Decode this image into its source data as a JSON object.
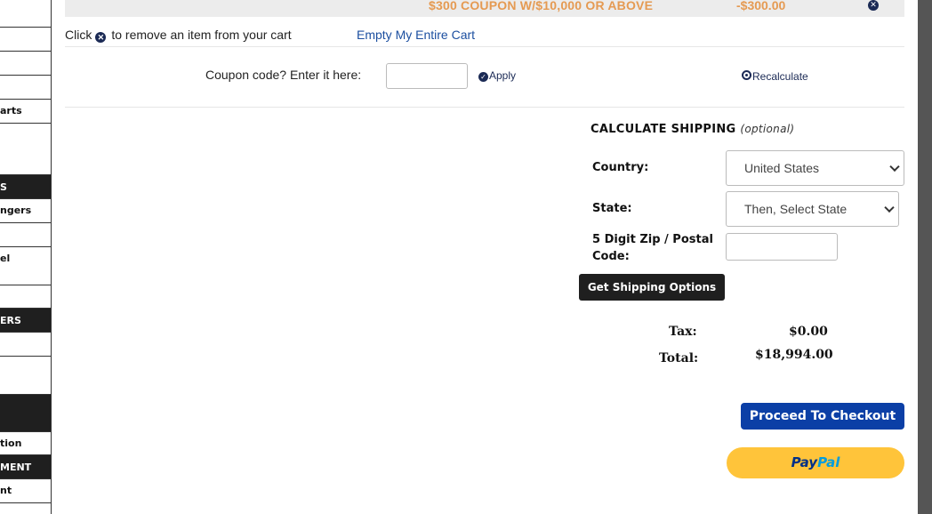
{
  "sidebar": {
    "items": [
      {
        "label": "",
        "dark": false
      },
      {
        "label": "",
        "dark": false
      },
      {
        "label": "",
        "dark": false
      },
      {
        "label": "",
        "dark": false
      },
      {
        "label": "arts",
        "dark": false
      },
      {
        "label": "",
        "dark": false
      },
      {
        "label": "S",
        "dark": true
      },
      {
        "label": "ngers",
        "dark": false
      },
      {
        "label": "",
        "dark": false
      },
      {
        "label": "el",
        "dark": false
      },
      {
        "label": "",
        "dark": false
      },
      {
        "label": "ERS",
        "dark": true
      },
      {
        "label": "",
        "dark": false
      },
      {
        "label": "",
        "dark": false
      },
      {
        "label": "",
        "dark": true
      },
      {
        "label": "tion",
        "dark": false
      },
      {
        "label": "MENT",
        "dark": true
      },
      {
        "label": "nt",
        "dark": false
      }
    ]
  },
  "coupon_line": {
    "name": "$300 COUPON W/$10,000 OR ABOVE",
    "amount": "-$300.00"
  },
  "remove_info": {
    "prefix": "Click",
    "suffix": "to remove an item from your cart",
    "empty_cart_link": "Empty My Entire Cart"
  },
  "coupon_form": {
    "label": "Coupon code? Enter it here:",
    "value": "",
    "apply_label": "Apply",
    "recalculate_label": "Recalculate"
  },
  "shipping": {
    "title": "CALCULATE SHIPPING",
    "optional": "(optional)",
    "country_label": "Country:",
    "country_value": "United States",
    "state_label": "State:",
    "state_value": "Then, Select State",
    "zip_label_1": "5 Digit Zip / Postal",
    "zip_label_2": "Code:",
    "zip_value": "",
    "button_label": "Get Shipping Options"
  },
  "totals": {
    "tax_label": "Tax:",
    "tax_value": "$0.00",
    "total_label": "Total:",
    "total_value": "$18,994.00"
  },
  "checkout": {
    "proceed_label": "Proceed To Checkout",
    "paypal_part1": "Pay",
    "paypal_part2": "Pal"
  },
  "colors": {
    "coupon_text": "#e59a52",
    "link": "#1c4fa0",
    "checkout_button": "#0b3fa6",
    "paypal_button": "#ffc43a",
    "dark_button": "#1f1f1f"
  }
}
